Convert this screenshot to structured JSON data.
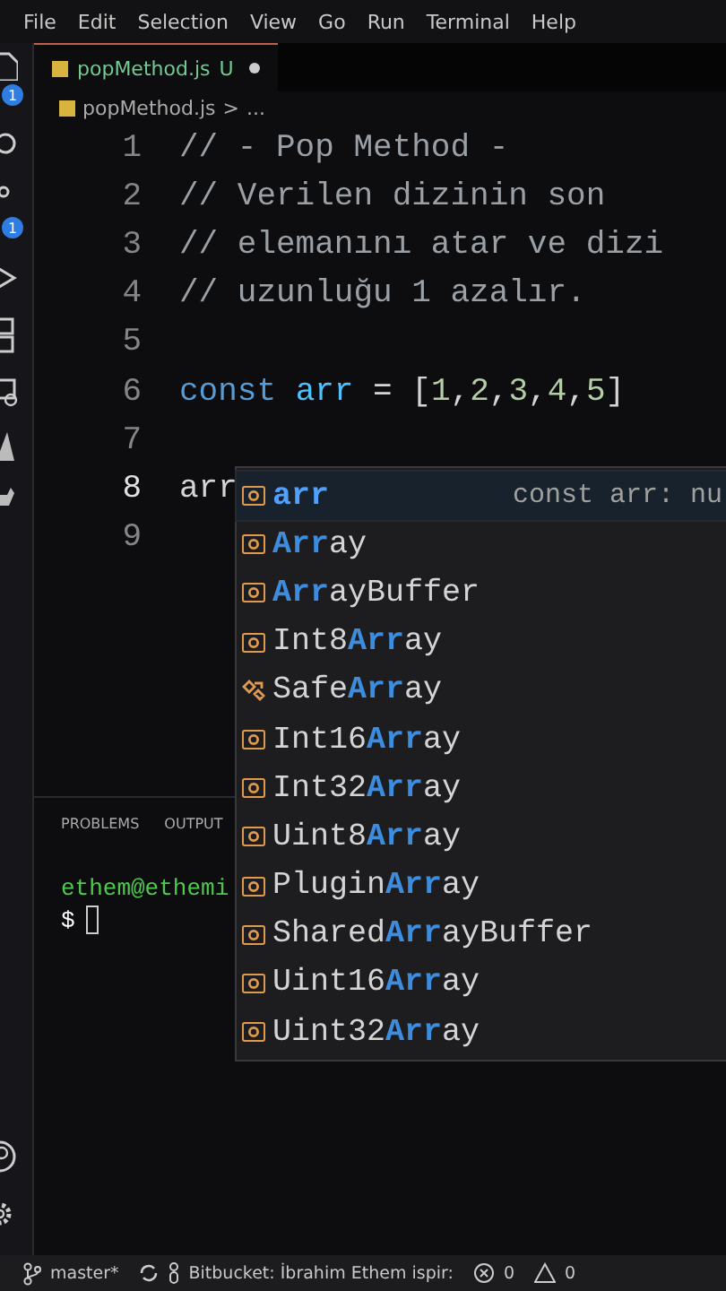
{
  "menu": [
    "File",
    "Edit",
    "Selection",
    "View",
    "Go",
    "Run",
    "Terminal",
    "Help"
  ],
  "tabs": [
    {
      "label": "popMethod.js",
      "status": "U",
      "modified": true,
      "selected": true
    }
  ],
  "breadcrumb": [
    "popMethod.js",
    ">",
    "..."
  ],
  "activity_badges": [
    "1",
    "1"
  ],
  "code": [
    {
      "number": "1",
      "tokens": [
        {
          "text": "// - Pop Method -",
          "kind": "comment"
        }
      ]
    },
    {
      "number": "2",
      "tokens": [
        {
          "text": "// Verilen dizinin son",
          "kind": "comment"
        }
      ]
    },
    {
      "number": "3",
      "tokens": [
        {
          "text": "// elemanını atar ve dizi",
          "kind": "comment"
        }
      ]
    },
    {
      "number": "4",
      "tokens": [
        {
          "text": "// uzunluğu 1 azalır.",
          "kind": "comment"
        }
      ]
    },
    {
      "number": "5"
    },
    {
      "number": "6",
      "tokens": [
        {
          "text": "const ",
          "kind": "keyword"
        },
        {
          "text": "arr",
          "kind": "variable"
        },
        {
          "text": " = [",
          "kind": "plain"
        },
        {
          "text": "1",
          "kind": "number"
        },
        {
          "text": ",",
          "kind": "plain"
        },
        {
          "text": "2",
          "kind": "number"
        },
        {
          "text": ",",
          "kind": "plain"
        },
        {
          "text": "3",
          "kind": "number"
        },
        {
          "text": ",",
          "kind": "plain"
        },
        {
          "text": "4",
          "kind": "number"
        },
        {
          "text": ",",
          "kind": "plain"
        },
        {
          "text": "5",
          "kind": "number"
        },
        {
          "text": "]",
          "kind": "plain"
        }
      ]
    },
    {
      "number": "7"
    },
    {
      "number": "8",
      "tokens": [
        {
          "text": "arr",
          "kind": "plain"
        }
      ],
      "cursor": true
    },
    {
      "number": "9"
    }
  ],
  "suggestions": [
    {
      "label": "**arr**",
      "kind": "variable",
      "detail": "const arr: nu",
      "selected": true
    },
    {
      "label": "**Arr**ay",
      "kind": "variable",
      "selected": false
    },
    {
      "label": "**Arr**ayBuffer",
      "kind": "variable",
      "selected": false
    },
    {
      "label": "Int8**Arr**ay",
      "kind": "variable",
      "selected": false
    },
    {
      "label": "Safe**Arr**ay",
      "kind": "class",
      "selected": false
    },
    {
      "label": "Int16**Arr**ay",
      "kind": "variable",
      "selected": false
    },
    {
      "label": "Int32**Arr**ay",
      "kind": "variable",
      "selected": false
    },
    {
      "label": "Uint8**Arr**ay",
      "kind": "variable",
      "selected": false
    },
    {
      "label": "Plugin**Arr**ay",
      "kind": "variable",
      "selected": false
    },
    {
      "label": "Shared**Arr**ayBuffer",
      "kind": "variable",
      "selected": false
    },
    {
      "label": "Uint16**Arr**ay",
      "kind": "variable",
      "selected": false
    },
    {
      "label": "Uint32**Arr**ay",
      "kind": "variable",
      "selected": false
    }
  ],
  "panel": {
    "tabs": [
      {
        "label": "PROBLEMS",
        "selected": false
      },
      {
        "label": "OUTPUT",
        "selected": false
      }
    ],
    "terminal": {
      "user": "ethem@ethemi",
      "prompt": "$"
    }
  },
  "status_bar": {
    "branch": "master*",
    "account": "Bitbucket: İbrahim Ethem ispir:",
    "errors": "0",
    "warnings": "0"
  }
}
